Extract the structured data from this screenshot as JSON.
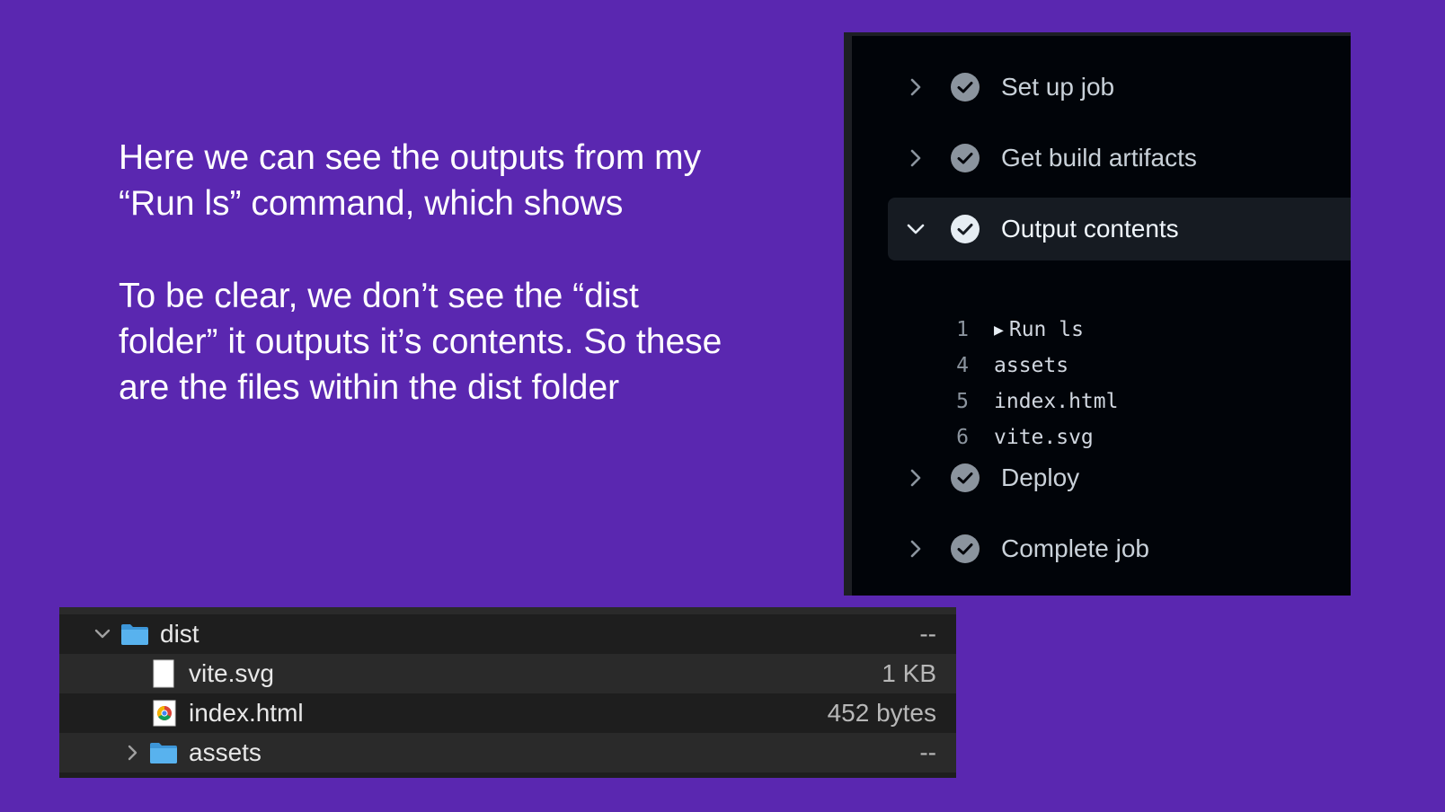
{
  "slide": {
    "paragraph1": "Here we can see the outputs from my “Run ls” command, which shows",
    "paragraph2": "To be clear, we don’t see the “dist folder” it outputs it’s contents. So these are the files within the dist folder"
  },
  "actions_log": {
    "steps": [
      {
        "label": "Set up job",
        "status": "success",
        "expanded": false
      },
      {
        "label": "Get build artifacts",
        "status": "success",
        "expanded": false
      },
      {
        "label": "Output contents",
        "status": "success",
        "expanded": true
      },
      {
        "label": "Deploy",
        "status": "success",
        "expanded": false
      },
      {
        "label": "Complete job",
        "status": "success",
        "expanded": false
      }
    ],
    "lines": [
      {
        "num": "1",
        "text": "Run ls",
        "group": true
      },
      {
        "num": "4",
        "text": "assets",
        "group": false
      },
      {
        "num": "5",
        "text": "index.html",
        "group": false
      },
      {
        "num": "6",
        "text": "vite.svg",
        "group": false
      }
    ]
  },
  "finder": {
    "rows": [
      {
        "name": "dist",
        "size": "--",
        "kind": "folder",
        "expanded": true
      },
      {
        "name": "vite.svg",
        "size": "1 KB",
        "kind": "file"
      },
      {
        "name": "index.html",
        "size": "452 bytes",
        "kind": "html"
      },
      {
        "name": "assets",
        "size": "--",
        "kind": "folder",
        "expanded": false
      }
    ]
  },
  "colors": {
    "background": "#5a27b0",
    "panel": "#010409",
    "success_check": "#8b949e",
    "folder_blue": "#4fa9e8"
  }
}
